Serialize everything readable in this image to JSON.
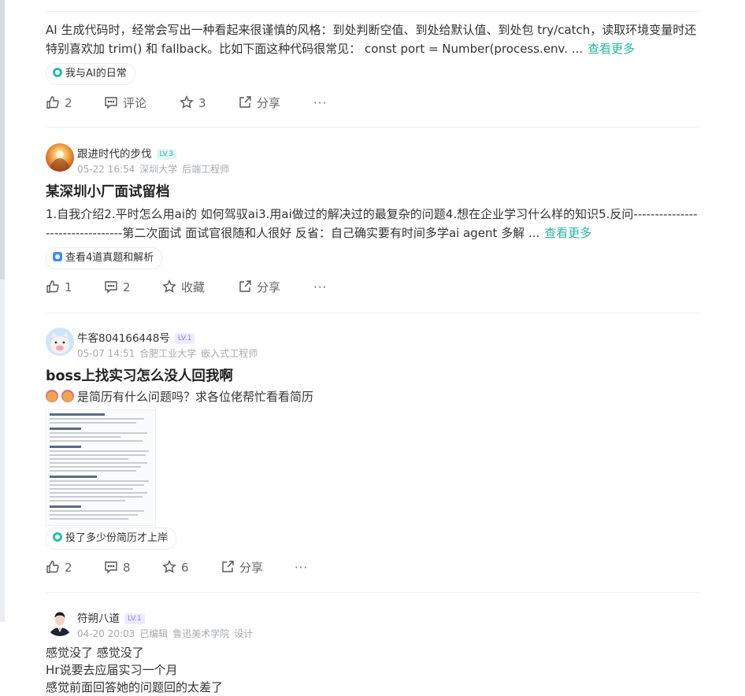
{
  "posts": [
    {
      "body": "AI 生成代码时，经常会写出一种看起来很谨慎的风格：到处判断空值、到处给默认值、到处包 try/catch，读取环境变量时还特别喜欢加 trim() 和 fallback。比如下面这种代码很常见： const port = Number(process.env. ...",
      "more": "查看更多",
      "tag": "我与AI的日常",
      "actions": {
        "like": "2",
        "comment": "评论",
        "star": "3",
        "share": "分享",
        "more": "···"
      }
    },
    {
      "user": {
        "name": "跟进时代的步伐",
        "level": "LV.3",
        "date": "05-22 16:54",
        "school": "深圳大学",
        "job": "后端工程师"
      },
      "title": "某深圳小厂面试留档",
      "body": "1.自我介绍2.平时怎么用ai的 如何驾驭ai3.用ai做过的解决过的最复杂的问题4.想在企业学习什么样的知识5.反问---------------------------------第二次面试 面试官很随和人很好 反省：自己确实要有时间多学ai agent 多解 ...",
      "more": "查看更多",
      "tag": "查看4道真题和解析",
      "actions": {
        "like": "1",
        "comment": "2",
        "star": "收藏",
        "share": "分享",
        "more": "···"
      }
    },
    {
      "user": {
        "name": "牛客804166448号",
        "level": "LV.1",
        "date": "05-07 14:51",
        "school": "合肥工业大学",
        "job": "嵌入式工程师"
      },
      "title": "boss上找实习怎么没人回我啊",
      "body": "是简历有什么问题吗？求各位佬帮忙看看简历",
      "tag": "投了多少份简历才上岸",
      "actions": {
        "like": "2",
        "comment": "8",
        "star": "6",
        "share": "分享",
        "more": "···"
      }
    },
    {
      "user": {
        "name": "符朔八道",
        "level": "LV.1",
        "date": "04-20 20:03",
        "edited": "已编辑",
        "school": "鲁迅美术学院",
        "job": "设计"
      },
      "lines": [
        "感觉没了 感觉没了",
        "Hr说要去应届实习一个月",
        "感觉前面回答她的问题回的太差了"
      ]
    }
  ],
  "icons": {
    "like": "thumb-up-icon",
    "comment": "comment-icon",
    "star": "star-icon",
    "share": "share-icon",
    "more": "more-icon"
  },
  "colors": {
    "accent": "#27b59f",
    "lv_teal": "#21b9a8",
    "lv_purple": "#8a7bff"
  }
}
